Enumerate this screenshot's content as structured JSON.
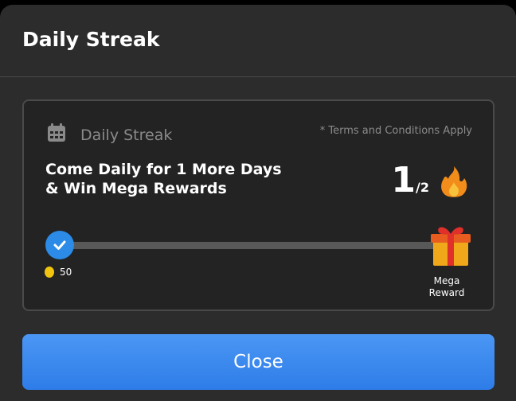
{
  "header": {
    "title": "Daily Streak"
  },
  "card": {
    "label": "Daily Streak",
    "calendar_icon": "calendar-icon",
    "terms": "* Terms and Conditions Apply",
    "message_line1": "Come Daily for 1 More Days",
    "message_line2": "& Win Mega Rewards",
    "streak_current": "1",
    "streak_total": "/2",
    "flame_icon": "flame-icon",
    "progress": 0,
    "day1_reward": "50",
    "coin_icon": "coin-icon",
    "check_icon": "check-icon",
    "gift_icon": "gift-icon",
    "mega_line1": "Mega",
    "mega_line2": "Reward"
  },
  "close_button": {
    "label": "Close"
  },
  "colors": {
    "accent": "#2e7ce8",
    "flame": "#f28c1b",
    "gift": "#f0a81a",
    "coin": "#f1c40f"
  }
}
